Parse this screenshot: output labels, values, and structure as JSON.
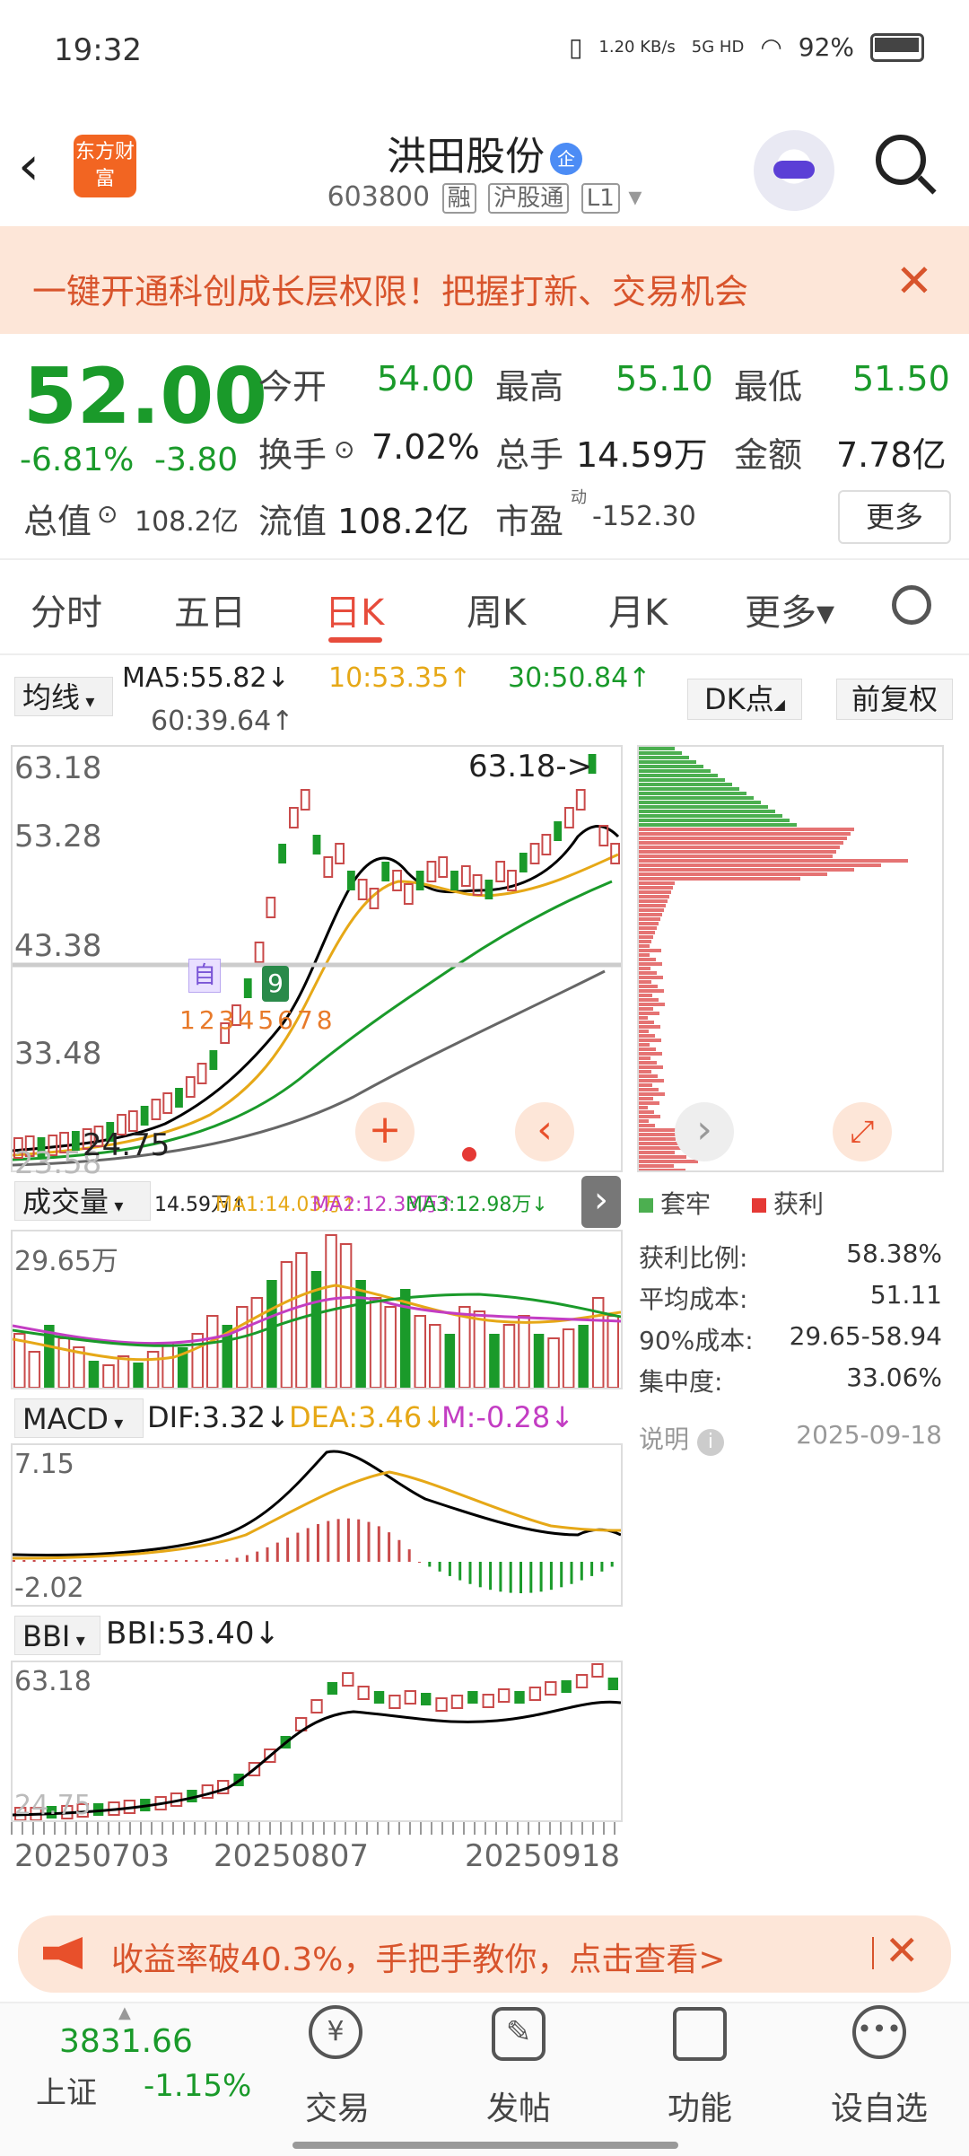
{
  "status": {
    "time": "19:32",
    "net_speed": "1.20 KB/s",
    "net_type": "5G HD",
    "battery": "92%"
  },
  "header": {
    "logo": "东方财富",
    "title": "洪田股份",
    "badge": "企",
    "code": "603800",
    "tags": [
      "融",
      "沪股通",
      "L1"
    ]
  },
  "banner": {
    "text": "一键开通科创成长层权限！把握打新、交易机会",
    "close": "✕"
  },
  "quote": {
    "price": "52.00",
    "pct": "-6.81%",
    "chg": "-3.80",
    "open_label": "今开",
    "open": "54.00",
    "high_label": "最高",
    "high": "55.10",
    "low_label": "最低",
    "low": "51.50",
    "turnover_label": "换手",
    "turnover": "7.02%",
    "volume_label": "总手",
    "volume": "14.59万",
    "amount_label": "金额",
    "amount": "7.78亿",
    "mktcap_label": "总值",
    "mktcap": "108.2亿",
    "float_label": "流值",
    "float": "108.2亿",
    "pe_label": "市盈",
    "pe_sup": "动",
    "pe": "-152.30",
    "more": "更多"
  },
  "tabs": [
    "分时",
    "五日",
    "日K",
    "周K",
    "月K",
    "更多▾"
  ],
  "active_tab": "日K",
  "ma": {
    "btn": "均线",
    "ma5": "MA5:55.82↓",
    "ma10": "10:53.35↑",
    "ma30": "30:50.84↑",
    "ma60": "60:39.64↑",
    "dk": "DK点",
    "fq": "前复权"
  },
  "kline": {
    "y_ticks": [
      "63.18",
      "53.28",
      "43.38",
      "33.48",
      "23.58"
    ],
    "max_label": "63.18->",
    "min_label": "24.75",
    "marker_self": "自",
    "marker_9": "9",
    "numbers": [
      "1",
      "2",
      "3",
      "4",
      "5",
      "6",
      "7",
      "8"
    ]
  },
  "volume": {
    "btn": "成交量",
    "vol": "14.59万↑",
    "ma1": "MA1:14.03万↑",
    "ma2": "MA2:12.33万↑",
    "ma3": "MA3:12.98万↓",
    "y_top": "29.65万"
  },
  "macd": {
    "btn": "MACD",
    "dif": "DIF:3.32↓",
    "dea": "DEA:3.46↓",
    "m": "M:-0.28↓",
    "y_top": "7.15",
    "y_bot": "-2.02"
  },
  "bbi": {
    "btn": "BBI",
    "val": "BBI:53.40↓",
    "y_top": "63.18",
    "y_bot": "24.75",
    "dates": [
      "20250703",
      "20250807",
      "20250918"
    ]
  },
  "chips": {
    "legend_trap": "套牢",
    "legend_profit": "获利",
    "rows": [
      {
        "k": "获利比例:",
        "v": "58.38%"
      },
      {
        "k": "平均成本:",
        "v": "51.11"
      },
      {
        "k": "90%成本:",
        "v": "29.65-58.94"
      },
      {
        "k": "集中度:",
        "v": "33.06%"
      }
    ],
    "note": "说明",
    "date": "2025-09-18"
  },
  "promo": {
    "text": "收益率破40.3%，手把手教你，点击查看>",
    "close": "✕"
  },
  "nav": {
    "index_val": "3831.66",
    "index_name": "上证",
    "index_pct": "-1.15%",
    "items": [
      "交易",
      "发帖",
      "功能",
      "设自选"
    ]
  },
  "colors": {
    "up": "#c94a4a",
    "down": "#1a9a2a",
    "accent": "#e74c3c",
    "banner_text": "#d8542c"
  }
}
